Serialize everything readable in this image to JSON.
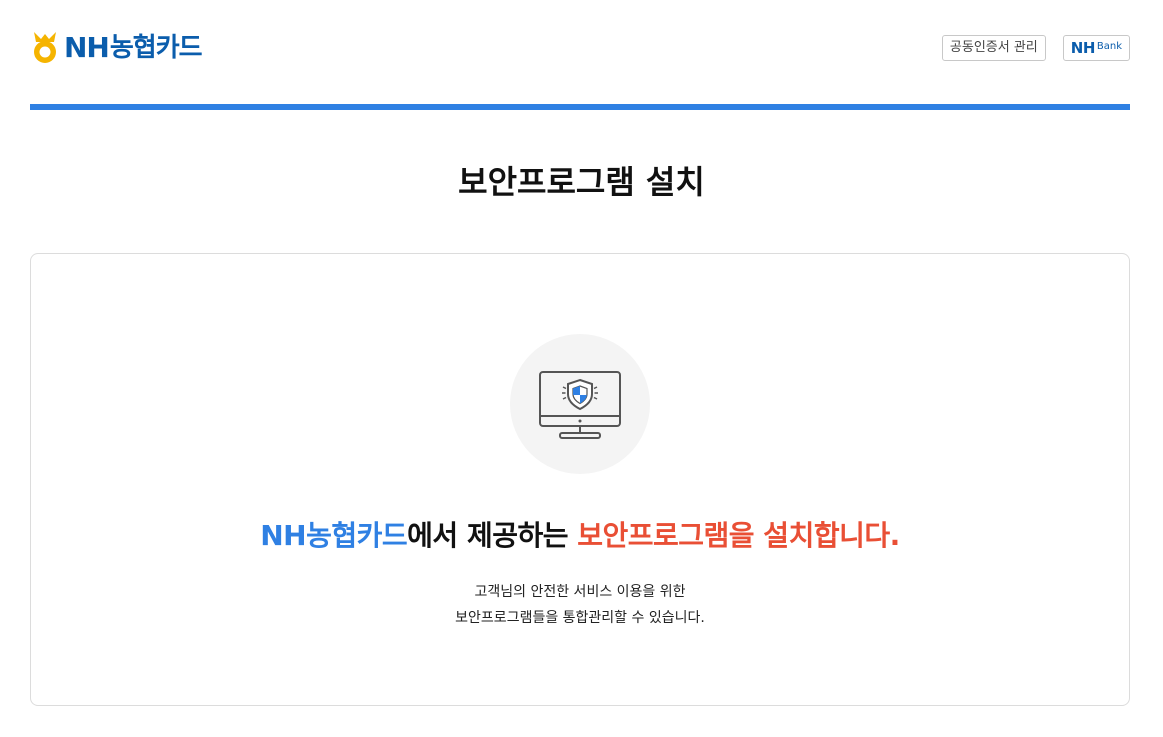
{
  "header": {
    "logo": {
      "nh": "NH",
      "name": "농협카드",
      "mark_color": "#f5b400",
      "brand_color": "#0b5dac"
    },
    "cert_button_label": "공동인증서 관리",
    "nhbank_button": {
      "nh": "NH",
      "bank": "Bank"
    },
    "bar_color": "#2f80e3"
  },
  "main": {
    "title": "보안프로그램 설치",
    "icon": "monitor-shield-icon",
    "headline": {
      "brand": "NH농협카드",
      "middle": "에서 제공하는 ",
      "highlight": "보안프로그램을 설치합니다.",
      "brand_color": "#2f80e3",
      "highlight_color": "#e94f35"
    },
    "description": {
      "line1": "고객님의 안전한 서비스 이용을 위한",
      "line2": "보안프로그램들을 통합관리할 수 있습니다."
    }
  }
}
